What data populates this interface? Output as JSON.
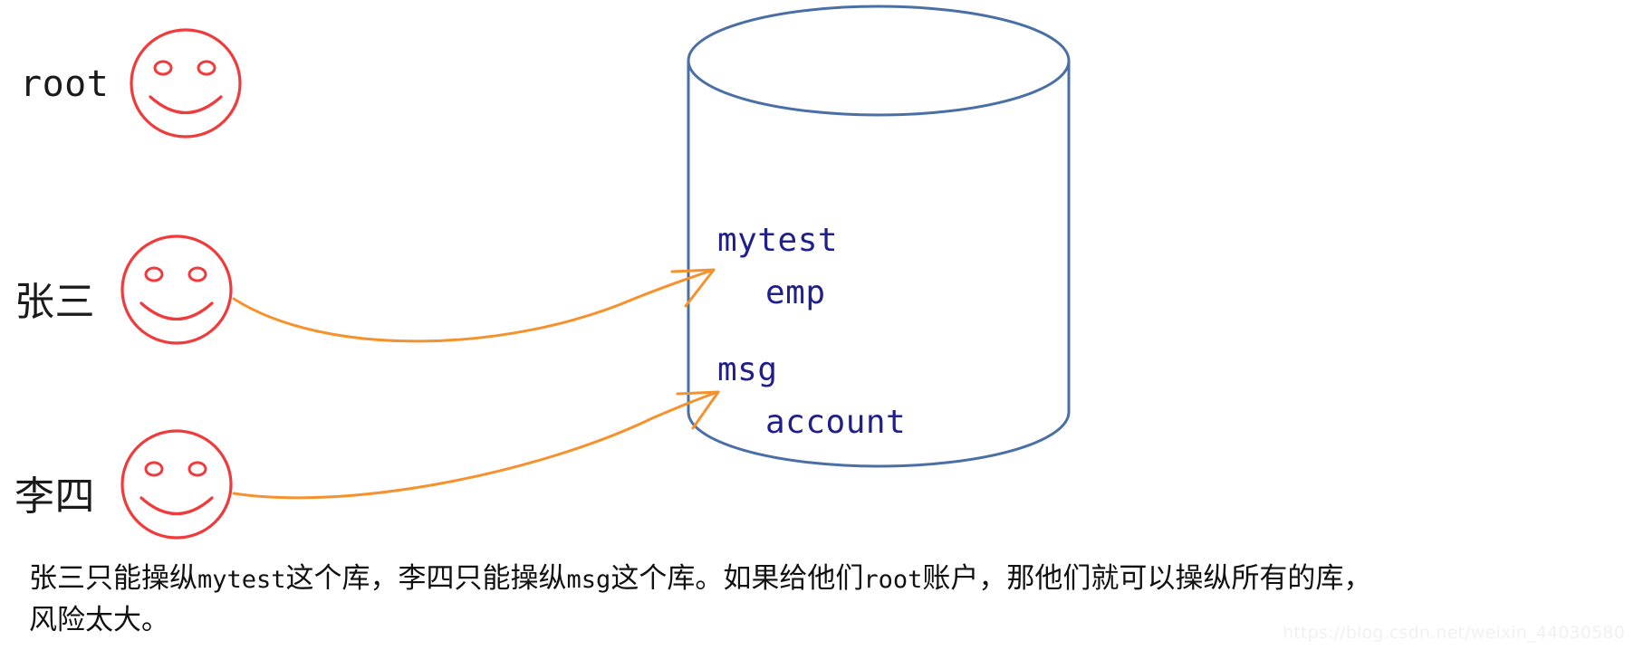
{
  "colors": {
    "face_stroke": "#ef3b3b",
    "cylinder_stroke": "#4a6fa5",
    "arrow_stroke": "#f5922e",
    "text_dark": "#111111",
    "db_text": "#20208c",
    "watermark": "#f0f1f3",
    "background": "#ffffff"
  },
  "people": [
    {
      "id": "root",
      "label": "root",
      "script": "latin"
    },
    {
      "id": "zhangsan",
      "label": "张三",
      "script": "cjk"
    },
    {
      "id": "lisi",
      "label": "李四",
      "script": "cjk"
    }
  ],
  "database": {
    "icon": "database-cylinder-icon",
    "entries": [
      {
        "name": "mytest",
        "level": 0
      },
      {
        "name": "emp",
        "level": 1
      },
      {
        "name": "msg",
        "level": 0
      },
      {
        "name": "account",
        "level": 1
      }
    ]
  },
  "arrows": [
    {
      "id": "zhangsan-to-mytest",
      "from": "zhangsan",
      "to": "mytest"
    },
    {
      "id": "lisi-to-msg",
      "from": "lisi",
      "to": "msg"
    }
  ],
  "caption": {
    "line1_part1": "张三只能操纵",
    "line1_mono1": "mytest",
    "line1_part2": "这个库，李四只能操纵",
    "line1_mono2": "msg",
    "line1_part3": "这个库。如果给他们",
    "line1_mono3": "root",
    "line1_part4": "账户，那他们就可以操纵所有的库，",
    "line2": "风险太大。"
  },
  "watermark": "https://blog.csdn.net/weixin_44030580"
}
